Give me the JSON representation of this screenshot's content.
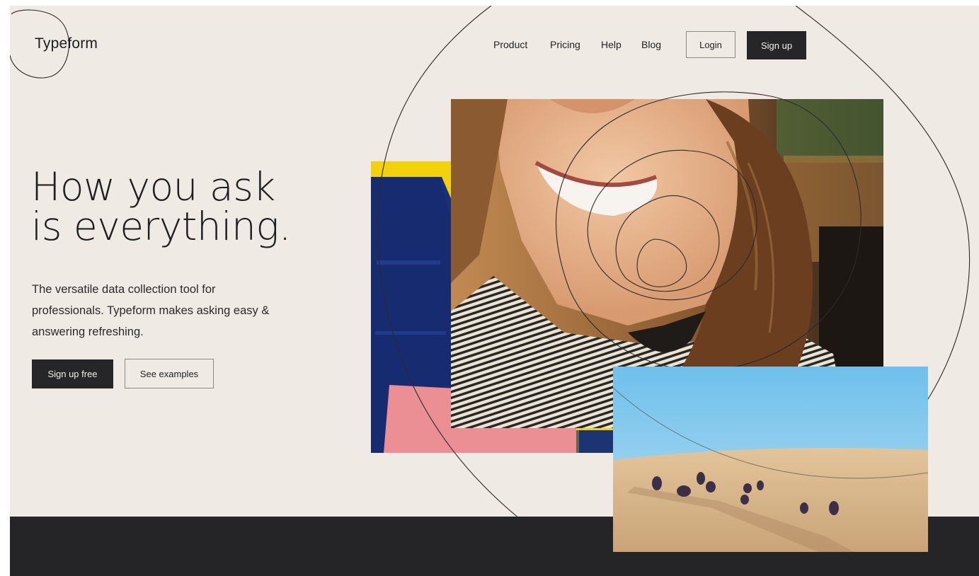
{
  "brand": {
    "name": "Typeform"
  },
  "nav": {
    "items": [
      {
        "label": "Product"
      },
      {
        "label": "Pricing"
      },
      {
        "label": "Help"
      },
      {
        "label": "Blog"
      }
    ],
    "login_label": "Login",
    "signup_label": "Sign up"
  },
  "hero": {
    "title_line1": "How you ask",
    "title_line2": "is everything.",
    "subtitle": "The versatile data collection tool for professionals. Typeform makes asking easy & answering refreshing.",
    "cta_primary": "Sign up free",
    "cta_secondary": "See examples"
  },
  "colors": {
    "background": "#efeae3",
    "dark": "#252527",
    "collage_yellow": "#f2d20a",
    "collage_blue": "#17307a",
    "collage_pink": "#eb8f95",
    "sky_blue": "#7cc4ea",
    "sand": "#d6b58b"
  },
  "images": {
    "collage": "abstract-collage",
    "portrait": "smiling-woman-photo",
    "landscape": "people-sitting-on-sand-dune-photo"
  }
}
